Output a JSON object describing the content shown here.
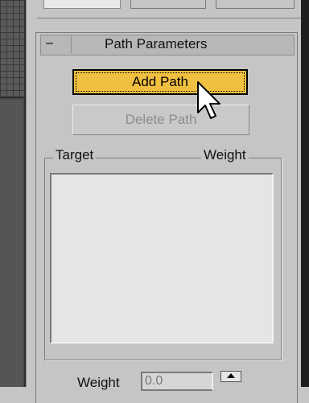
{
  "rollout": {
    "collapse_symbol": "–",
    "title": "Path Parameters"
  },
  "buttons": {
    "add_path": "Add Path",
    "delete_path": "Delete Path"
  },
  "target_list": {
    "target_header": "Target",
    "weight_header": "Weight",
    "items": []
  },
  "weight": {
    "label": "Weight",
    "value": "0.0"
  },
  "colors": {
    "active_button": "#f0c040",
    "panel_background": "#c5c5c5"
  },
  "icons": {
    "cursor": "arrow-pointer-icon",
    "spinner_up": "spinner-up-icon"
  }
}
